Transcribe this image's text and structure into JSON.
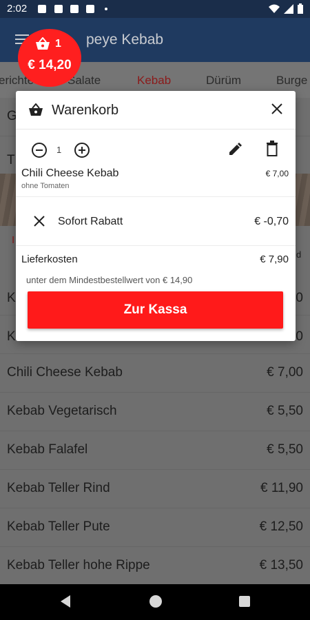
{
  "status_bar": {
    "time": "2:02"
  },
  "app_bar": {
    "title": "peye Kebab"
  },
  "cart_badge": {
    "count": "1",
    "total": "€ 14,20"
  },
  "tabs": [
    {
      "label": "erichte"
    },
    {
      "label": "Salate"
    },
    {
      "label": "Kebab"
    },
    {
      "label": "Dürüm"
    },
    {
      "label": "Burge"
    }
  ],
  "background_list": {
    "partial_top": [
      {
        "name": "G"
      },
      {
        "name": "T"
      },
      {
        "name": "K",
        "price": "0"
      },
      {
        "name": "K",
        "price": "0"
      }
    ],
    "partial_side": {
      "left_red": "I",
      "right_d": "d"
    },
    "items": [
      {
        "name": "Chili Cheese Kebab",
        "price": "€ 7,00"
      },
      {
        "name": "Kebab Vegetarisch",
        "price": "€ 5,50"
      },
      {
        "name": "Kebab Falafel",
        "price": "€ 5,50"
      },
      {
        "name": "Kebab Teller Rind",
        "price": "€ 11,90"
      },
      {
        "name": "Kebab Teller Pute",
        "price": "€ 12,50"
      },
      {
        "name": "Kebab Teller hohe Rippe",
        "price": "€ 13,50"
      }
    ]
  },
  "cart_dialog": {
    "title": "Warenkorb",
    "quantity": "1",
    "item": {
      "name": "Chili Cheese Kebab",
      "price": "€ 7,00",
      "note": "ohne Tomaten"
    },
    "discount": {
      "label": "Sofort Rabatt",
      "amount": "€ -0,70"
    },
    "delivery": {
      "label": "Lieferkosten",
      "amount": "€ 7,90"
    },
    "minimum_note": "unter dem Mindestbestellwert von € 14,90",
    "checkout_label": "Zur Kassa"
  },
  "colors": {
    "accent_red": "#ff1a1a",
    "app_bar": "#1f3a60",
    "status_bar": "#1a2d4a"
  }
}
